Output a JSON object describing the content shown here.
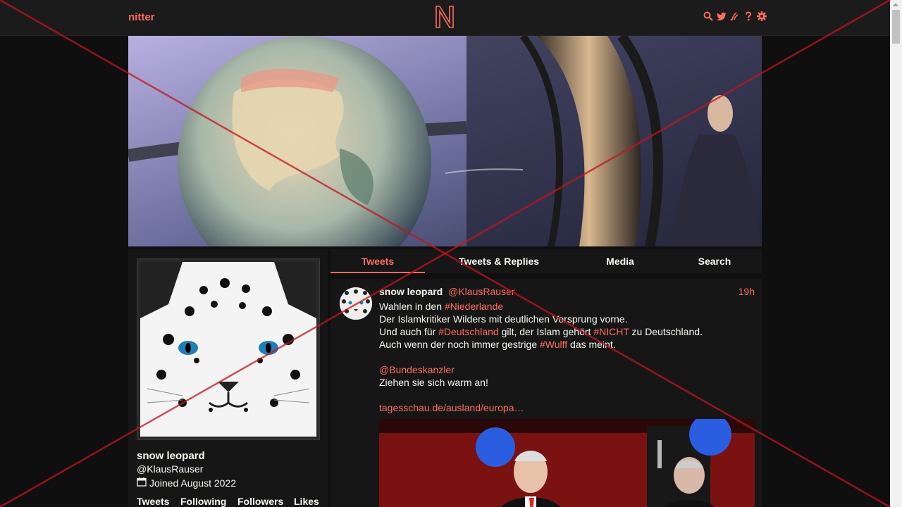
{
  "nav": {
    "brand": "nitter",
    "logo": "N",
    "icons": [
      "search-icon",
      "twitter-icon",
      "rss-icon",
      "help-icon",
      "gear-icon"
    ],
    "accent": "#ff6c60"
  },
  "profile": {
    "name": "snow leopard",
    "handle": "@KlausRauser",
    "joined": "Joined August 2022",
    "stats": [
      "Tweets",
      "Following",
      "Followers",
      "Likes"
    ]
  },
  "tabs": [
    {
      "label": "Tweets",
      "active": true
    },
    {
      "label": "Tweets & Replies",
      "active": false
    },
    {
      "label": "Media",
      "active": false
    },
    {
      "label": "Search",
      "active": false
    }
  ],
  "tweet": {
    "name": "snow leopard",
    "handle": "@KlausRauser",
    "time": "19h",
    "lines": [
      [
        {
          "t": "Wahlen in den "
        },
        {
          "t": "#Niederlande",
          "link": true
        }
      ],
      [
        {
          "t": "Der Islamkritiker Wilders mit deutlichen Vorsprung vorne."
        }
      ],
      [
        {
          "t": "Und auch für "
        },
        {
          "t": "#Deutschland",
          "link": true
        },
        {
          "t": " gilt, der Islam gehört "
        },
        {
          "t": "#NICHT",
          "link": true
        },
        {
          "t": " zu Deutschland."
        }
      ],
      [
        {
          "t": "Auch wenn der noch immer gestrige "
        },
        {
          "t": "#Wulff",
          "link": true
        },
        {
          "t": " das meint."
        }
      ],
      [],
      [
        {
          "t": "@Bundeskanzler",
          "link": true
        }
      ],
      [
        {
          "t": "Ziehen sie sich warm an!"
        }
      ],
      [],
      [
        {
          "t": "tagesschau.de/ausland/europa…",
          "link": true
        }
      ]
    ]
  }
}
